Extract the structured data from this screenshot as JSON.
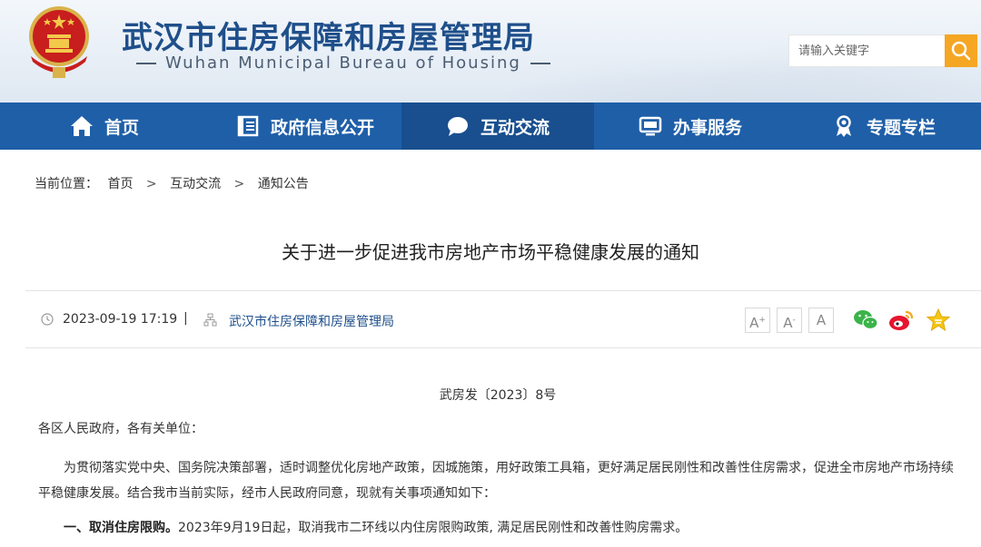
{
  "site": {
    "title": "武汉市住房保障和房屋管理局",
    "subtitle": "Wuhan Municipal Bureau of Housing"
  },
  "search": {
    "placeholder": "请输入关键字"
  },
  "nav": {
    "items": [
      {
        "label": "首页",
        "icon": "home-icon"
      },
      {
        "label": "政府信息公开",
        "icon": "document-icon"
      },
      {
        "label": "互动交流",
        "icon": "chat-bubble-icon"
      },
      {
        "label": "办事服务",
        "icon": "monitor-icon"
      },
      {
        "label": "专题专栏",
        "icon": "award-icon"
      }
    ],
    "active_index": 2
  },
  "breadcrumb": {
    "prefix": "当前位置：",
    "items": [
      "首页",
      "互动交流",
      "通知公告"
    ],
    "separator": ">"
  },
  "article": {
    "title": "关于进一步促进我市房地产市场平稳健康发展的通知",
    "date": "2023-09-19 17:19",
    "divider": "|",
    "source": "武汉市住房保障和房屋管理局",
    "doc_number": "武房发〔2023〕8号",
    "salutation": "各区人民政府，各有关单位：",
    "intro": "为贯彻落实党中央、国务院决策部署，适时调整优化房地产政策，因城施策，用好政策工具箱，更好满足居民刚性和改善性住房需求，促进全市房地产市场持续平稳健康发展。结合我市当前实际，经市人民政府同意，现就有关事项通知如下：",
    "item1_heading": "一、取消住房限购。",
    "item1_text": "2023年9月19日起，取消我市二环线以内住房限购政策, 满足居民刚性和改善性购房需求。"
  },
  "font_controls": [
    {
      "label": "A",
      "sup": "+"
    },
    {
      "label": "A",
      "sup": "-"
    },
    {
      "label": "A",
      "sup": ""
    }
  ],
  "share": [
    "wechat-icon",
    "weibo-icon",
    "favorite-star-icon"
  ],
  "colors": {
    "brand_blue": "#1f5fa8",
    "title_blue": "#1f4f8a",
    "search_button": "#f5a623"
  }
}
